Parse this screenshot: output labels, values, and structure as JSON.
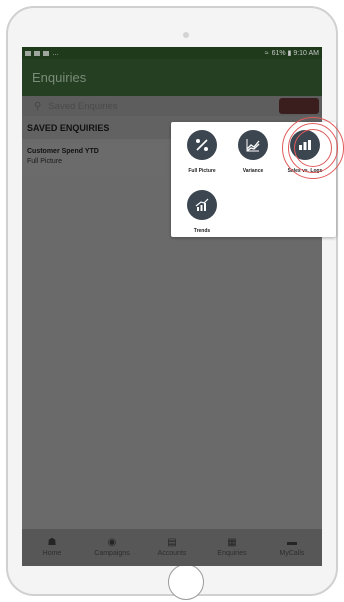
{
  "statusbar": {
    "left_text": "…",
    "right_text": "61% ▮ 9:10 AM"
  },
  "appbar": {
    "title": "Enquiries"
  },
  "search": {
    "placeholder": "Saved Enquiries"
  },
  "section": {
    "title": "SAVED ENQUIRIES"
  },
  "saved_items": [
    {
      "title": "Customer Spend YTD",
      "subtitle": "Full Picture"
    }
  ],
  "popup": {
    "tiles": [
      {
        "label": "Full Picture",
        "icon": "full-picture-icon"
      },
      {
        "label": "Variance",
        "icon": "variance-chart-icon"
      },
      {
        "label": "Sales vs. Logs",
        "icon": "sales-vs-logs-icon"
      },
      {
        "label": "Trends",
        "icon": "trends-chart-icon"
      }
    ]
  },
  "bottom_nav": [
    {
      "label": "Home",
      "icon": "home-icon"
    },
    {
      "label": "Campaigns",
      "icon": "campaigns-icon"
    },
    {
      "label": "Accounts",
      "icon": "accounts-icon"
    },
    {
      "label": "Enquiries",
      "icon": "enquiries-icon"
    },
    {
      "label": "MyCalls",
      "icon": "mycalls-icon"
    }
  ],
  "colors": {
    "status_bar": "#1e3a1b",
    "app_bar": "#253f22",
    "overlay": "#6a6a6a",
    "icon_circle": "#3c4650",
    "highlight": "#e05a5a"
  }
}
